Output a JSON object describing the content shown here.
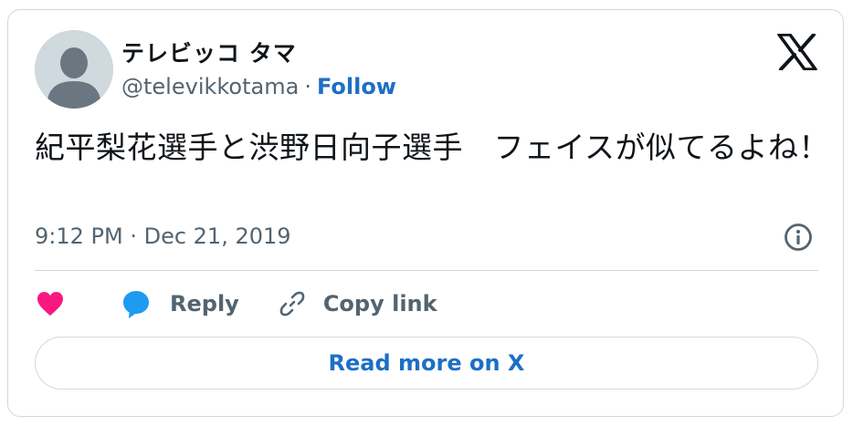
{
  "author": {
    "display_name": "テレビッコ タマ",
    "handle": "@televikkotama",
    "separator": "·",
    "follow_label": "Follow"
  },
  "tweet": {
    "text": "紀平梨花選手と渋野日向子選手　フェイスが似てるよね！",
    "timestamp": "9:12 PM · Dec 21, 2019"
  },
  "actions": {
    "reply_label": "Reply",
    "copy_link_label": "Copy link"
  },
  "read_more_label": "Read more on X",
  "icons": {
    "logo": "x-logo-icon",
    "info": "info-icon",
    "like": "heart-icon",
    "reply": "speech-bubble-icon",
    "copy": "link-icon"
  },
  "colors": {
    "follow": "#1d6fc4",
    "heart": "#f91880",
    "reply_bubble": "#1d9bf0",
    "secondary_text": "#536471",
    "border": "#cfd9de"
  }
}
